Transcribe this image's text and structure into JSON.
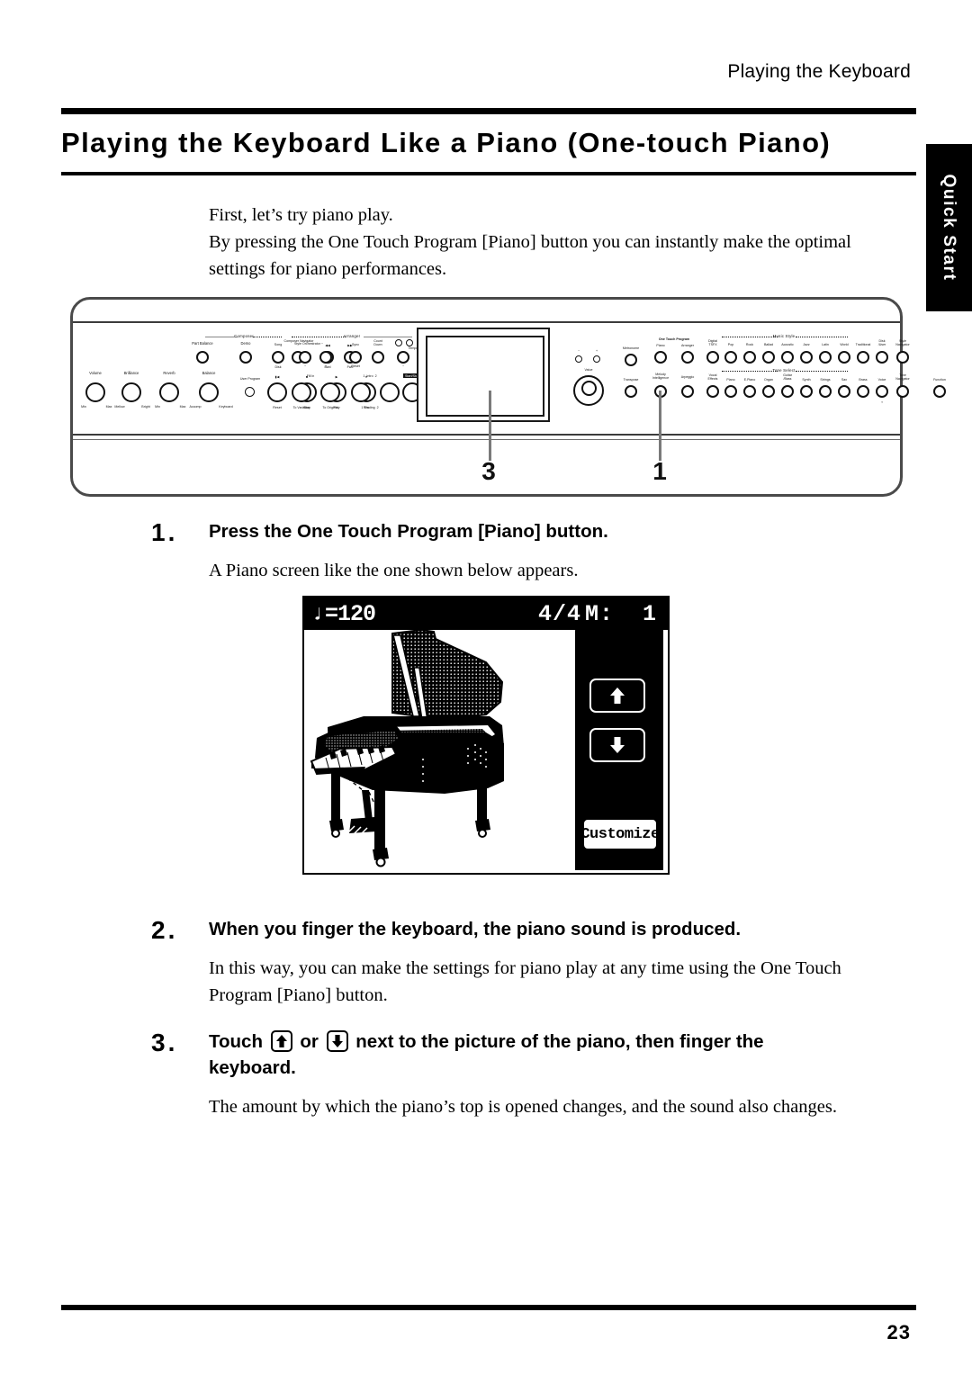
{
  "running_head": "Playing the Keyboard",
  "page_title": "Playing the Keyboard Like a Piano (One-touch Piano)",
  "thumb_tab": {
    "label": "Quick Start"
  },
  "intro": {
    "line1": "First, let’s try piano play.",
    "line2": "By pressing the One Touch Program [Piano] button you can instantly make the optimal",
    "line3": "settings for piano performances."
  },
  "panel_figure": {
    "callouts": [
      {
        "number": "3",
        "points_to": "display"
      },
      {
        "number": "1",
        "points_to": "one-touch-program-piano-button"
      }
    ],
    "sections": {
      "composer": "Composer",
      "arranger": "Arranger",
      "music_style": "Music Style",
      "tone_select": "Tone Select",
      "one_touch_program": "One Touch Program"
    },
    "knobs": [
      {
        "label": "Volume",
        "sub_left": "Min",
        "sub_right": "Max"
      },
      {
        "label": "Brilliance",
        "sub_left": "Mellow",
        "sub_right": "Bright"
      },
      {
        "label": "Reverb",
        "sub_left": "Min",
        "sub_right": "Max"
      },
      {
        "label": "Balance",
        "sub_left": "Accomp",
        "sub_right": "Keyboard"
      }
    ],
    "buttons_left": [
      "User Program",
      "Part Balance",
      "Demo"
    ],
    "composer_buttons": [
      "Song",
      "Disk",
      "Composer Navigator",
      "Bwd",
      "Fwd",
      "Reset",
      "Stop",
      "Play",
      "Rec"
    ],
    "arranger_buttons": [
      "Style Orchestrator −",
      "Style Orchestrator +",
      "Sync",
      "Reset",
      "Count Down",
      "Tempo −",
      "Tempo +",
      "Fill In To Variation",
      "Fill In To Original",
      "Intro 1",
      "Intro 2",
      "Ending 1",
      "Ending 2",
      "Start/Stop"
    ],
    "center_buttons": [
      "Value −",
      "Value +",
      "Value",
      "Metronome",
      "Transpose",
      "One Touch Program Piano",
      "One Touch Program Arranger",
      "Melody Intelligence",
      "Arpeggio",
      "Digital TSFX",
      "Vocal Effects"
    ],
    "music_style_buttons": [
      "Pop",
      "Rock",
      "Ballad",
      "Acoustic",
      "Jazz",
      "Latin",
      "World",
      "Traditional",
      "Disk /User",
      "Style Navigator"
    ],
    "tone_select_buttons": [
      "Piano",
      "E.Piano",
      "Organ",
      "Guitar /Bass",
      "Synth",
      "Strings",
      "Sax",
      "Brass",
      "Voice",
      "Tone Navigator"
    ],
    "function_button": "Function"
  },
  "steps": [
    {
      "number": "1.",
      "heading": "Press the One Touch Program [Piano] button.",
      "body": [
        "A Piano screen like the one shown below appears."
      ]
    },
    {
      "number": "2.",
      "heading": "When you finger the keyboard, the piano sound is produced.",
      "body": [
        "In this way, you can make the settings for piano play at any time using the One Touch",
        "Program [Piano] button."
      ]
    },
    {
      "number": "3.",
      "heading_before": "Touch",
      "heading_mid": "or",
      "heading_after": "next to the picture of the piano, then finger the",
      "heading_line2": "keyboard.",
      "body": [
        "The amount by which the piano’s top is opened changes, and the sound also changes."
      ]
    }
  ],
  "lcd_screen": {
    "tempo": "♩=120",
    "beat": "4/4",
    "measure_label": "M:",
    "measure_value": "1",
    "up_button": "up-arrow",
    "down_button": "down-arrow",
    "customize_button": "Customize",
    "illustration": "grand-piano"
  },
  "footer": {
    "page_number": "23"
  }
}
